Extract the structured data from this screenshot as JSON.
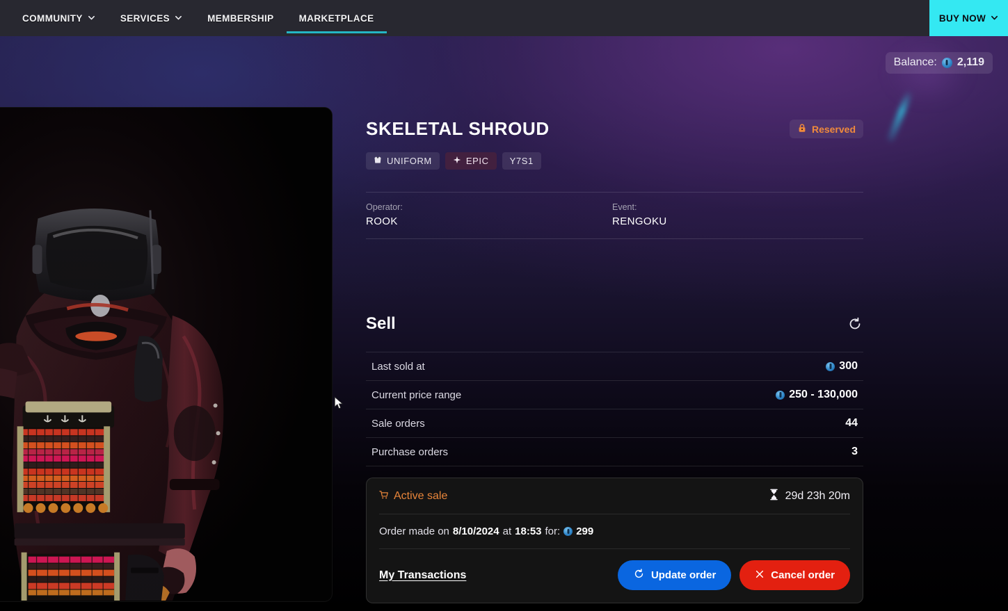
{
  "nav": {
    "items": [
      {
        "label": "COMMUNITY",
        "has_caret": true,
        "active": false
      },
      {
        "label": "SERVICES",
        "has_caret": true,
        "active": false
      },
      {
        "label": "MEMBERSHIP",
        "has_caret": false,
        "active": false
      },
      {
        "label": "MARKETPLACE",
        "has_caret": false,
        "active": true
      }
    ],
    "buy_now_label": "BUY NOW"
  },
  "balance": {
    "label": "Balance:",
    "amount": "2,119"
  },
  "item": {
    "title": "SKELETAL SHROUD",
    "status_badge": "Reserved",
    "tags": [
      {
        "label": "UNIFORM",
        "icon": "uniform-icon",
        "style": "default"
      },
      {
        "label": "EPIC",
        "icon": "rarity-star-icon",
        "style": "epic"
      },
      {
        "label": "Y7S1",
        "icon": null,
        "style": "default"
      }
    ],
    "meta": [
      {
        "label": "Operator:",
        "value": "ROOK"
      },
      {
        "label": "Event:",
        "value": "RENGOKU"
      }
    ]
  },
  "sell": {
    "title": "Sell",
    "refresh_icon": "refresh-icon",
    "stats": [
      {
        "label": "Last sold at",
        "value": "300",
        "has_coin": true
      },
      {
        "label": "Current price range",
        "value": "250 - 130,000",
        "has_coin": true
      },
      {
        "label": "Sale orders",
        "value": "44",
        "has_coin": false
      },
      {
        "label": "Purchase orders",
        "value": "3",
        "has_coin": false
      }
    ],
    "active_sale": {
      "status_label": "Active sale",
      "status_icon": "cart-icon",
      "timer": "29d 23h 20m",
      "timer_icon": "hourglass-icon",
      "order_prefix": "Order made on",
      "order_date": "8/10/2024",
      "order_at": "at",
      "order_time": "18:53",
      "order_for": "for:",
      "order_price": "299",
      "transactions_link": "My Transactions",
      "update_button": "Update order",
      "cancel_button": "Cancel order"
    }
  },
  "colors": {
    "accent_cyan": "#34e8f2",
    "active_tab": "#24b6c4",
    "reserved_orange": "#f08a3c",
    "active_sale_orange": "#e8853a",
    "update_blue": "#0a66e0",
    "cancel_red": "#e32010",
    "epic_purple": "#42203f",
    "coin_blue": "#2f86c9"
  }
}
